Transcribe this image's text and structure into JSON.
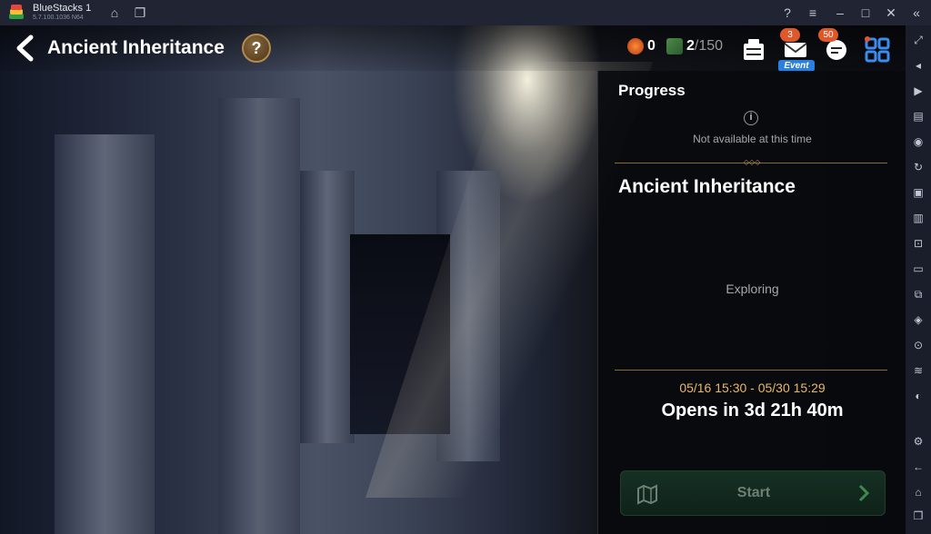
{
  "app": {
    "name": "BlueStacks 1",
    "version": "5.7.100.1036  N64"
  },
  "header": {
    "title": "Ancient Inheritance",
    "help_label": "?",
    "resources": [
      {
        "name": "essence-icon",
        "value": "0"
      },
      {
        "name": "stamina-icon",
        "value": "2",
        "max": "/150"
      }
    ],
    "mail_badge": "3",
    "event_label": "Event",
    "chat_badge": "50"
  },
  "panel": {
    "progress_heading": "Progress",
    "info_symbol": "i",
    "not_available": "Not available at this time",
    "event_title": "Ancient Inheritance",
    "status": "Exploring",
    "dates": "05/16 15:30 - 05/30 15:29",
    "opens": "Opens in  3d 21h 40m",
    "start_label": "Start"
  },
  "colors": {
    "accent_gold": "#e9b86a",
    "badge": "#e0572a",
    "event_blue": "#2a7fe0",
    "start_green": "#163024"
  }
}
